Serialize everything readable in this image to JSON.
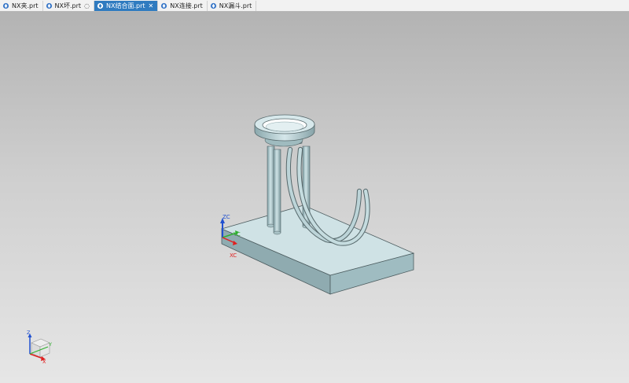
{
  "tabs": [
    {
      "label": "NX夹.prt",
      "active": false,
      "extra": ""
    },
    {
      "label": "NX坏.prt",
      "active": false,
      "extra": "◌"
    },
    {
      "label": "NX结合面.prt",
      "active": true,
      "extra": "✕"
    },
    {
      "label": "NX连接.prt",
      "active": false,
      "extra": ""
    },
    {
      "label": "NX漏斗.prt",
      "active": false,
      "extra": ""
    }
  ],
  "csys": {
    "zc_label": "ZC",
    "yc_label": "YC",
    "xc_label": "XC"
  },
  "triad": {
    "z_label": "Z",
    "y_label": "Y",
    "x_label": "X"
  },
  "colors": {
    "accent": "#2f7bc0",
    "model": "#a9c9cf",
    "axis_x": "#e02020",
    "axis_y": "#30b030",
    "axis_z": "#2050d0"
  }
}
